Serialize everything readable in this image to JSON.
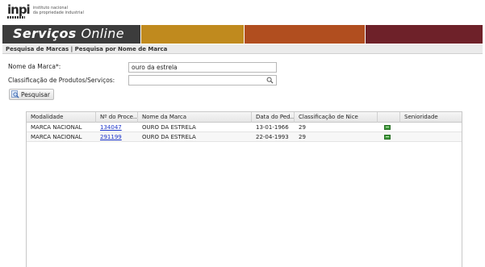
{
  "logo": {
    "mark": "inpi",
    "line1": "instituto nacional",
    "line2": "da propriedade industrial"
  },
  "banner": {
    "title_part1": "Serviços ",
    "title_part2": "Online",
    "colors": [
      "#3c3c3c",
      "#c08a1e",
      "#b14e1f",
      "#6e2129"
    ]
  },
  "breadcrumb": "Pesquisa de Marcas | Pesquisa por Nome de Marca",
  "form": {
    "brand_name_label": "Nome da Marca*:",
    "brand_name_value": "ouro da estrela",
    "classification_label": "Classificação de Produtos/Serviços:",
    "classification_value": "",
    "search_button": "Pesquisar"
  },
  "grid": {
    "columns": [
      "Modalidade",
      "Nº do Proce...",
      "Nome da Marca",
      "Data do Ped...",
      "Classificação de Nice",
      "",
      "Senioridade"
    ],
    "rows": [
      {
        "modalidade": "MARCA NACIONAL",
        "numero": "134047",
        "nome": "OURO DA ESTRELA",
        "data": "13-01-1966",
        "classificacao": "29",
        "senioridade": ""
      },
      {
        "modalidade": "MARCA NACIONAL",
        "numero": "291199",
        "nome": "OURO DA ESTRELA",
        "data": "22-04-1993",
        "classificacao": "29",
        "senioridade": ""
      }
    ]
  }
}
